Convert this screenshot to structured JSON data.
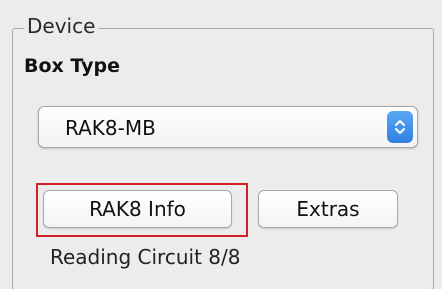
{
  "group": {
    "title": "Device"
  },
  "box_type": {
    "label": "Box Type",
    "selected": "RAK8-MB"
  },
  "buttons": {
    "info_label": "RAK8 Info",
    "extras_label": "Extras"
  },
  "status": {
    "text": "Reading Circuit 8/8"
  },
  "colors": {
    "highlight": "#d11f26",
    "stepper_accent": "#2f7fe0"
  },
  "icons": {
    "stepper": "up-down-chevron-icon"
  }
}
